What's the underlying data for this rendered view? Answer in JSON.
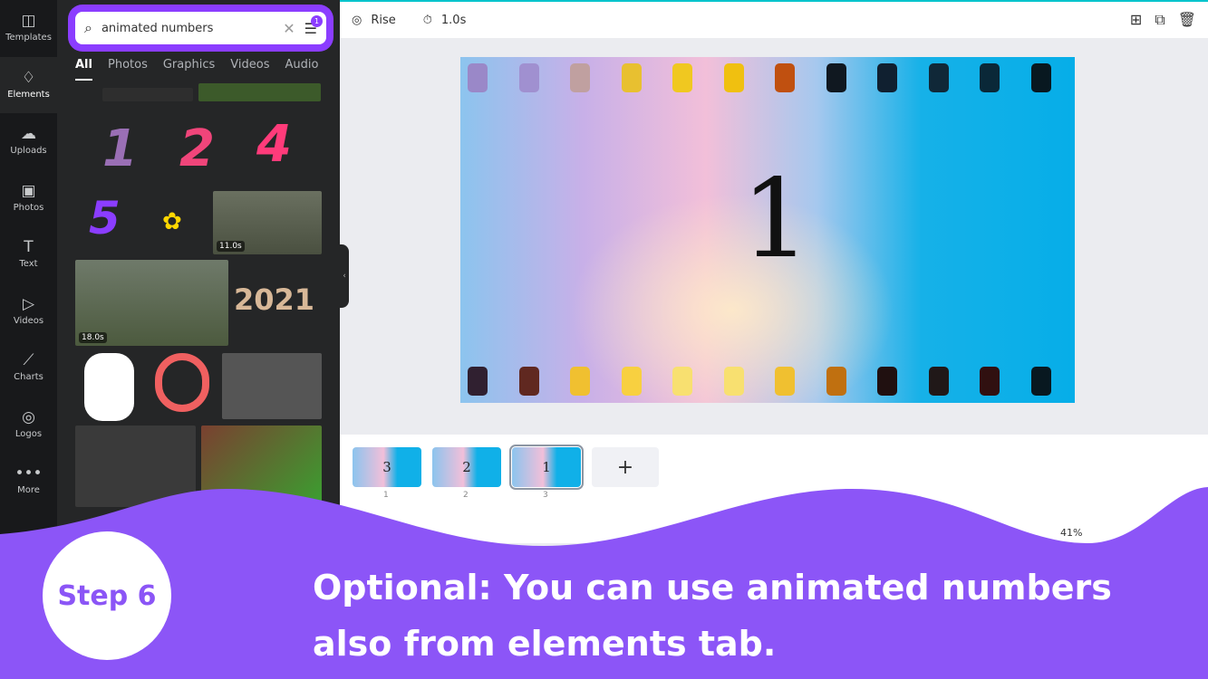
{
  "rail": [
    {
      "label": "Templates",
      "icon": "templates-icon",
      "glyph": "◫"
    },
    {
      "label": "Elements",
      "icon": "elements-icon",
      "glyph": "♢",
      "active": true
    },
    {
      "label": "Uploads",
      "icon": "upload-icon",
      "glyph": "☁"
    },
    {
      "label": "Photos",
      "icon": "photos-icon",
      "glyph": "▣"
    },
    {
      "label": "Text",
      "icon": "text-icon",
      "glyph": "T"
    },
    {
      "label": "Videos",
      "icon": "videos-icon",
      "glyph": "▷"
    },
    {
      "label": "Charts",
      "icon": "charts-icon",
      "glyph": "⟋"
    },
    {
      "label": "Logos",
      "icon": "logos-icon",
      "glyph": "◎"
    },
    {
      "label": "More",
      "icon": "more-icon",
      "glyph": "•••"
    }
  ],
  "search": {
    "value": "animated numbers",
    "filter_badge": "1"
  },
  "tabs": [
    "All",
    "Photos",
    "Graphics",
    "Videos",
    "Audio"
  ],
  "results": {
    "num1": "1",
    "num2": "2",
    "num4": "4",
    "num5": "5",
    "year": "2021",
    "dur1": "11.0s",
    "dur2": "18.0s"
  },
  "topbar": {
    "animation": "Rise",
    "duration": "1.0s"
  },
  "canvas": {
    "number": "1"
  },
  "pages": [
    {
      "label": "3",
      "num": "1"
    },
    {
      "label": "2",
      "num": "2"
    },
    {
      "label": "1",
      "num": "3"
    }
  ],
  "add_page": "+",
  "zoom": "41%",
  "overlay": {
    "step": "Step 6",
    "caption": "Optional: You can use animated numbers also from elements tab.",
    "color": "#8c55f7"
  }
}
